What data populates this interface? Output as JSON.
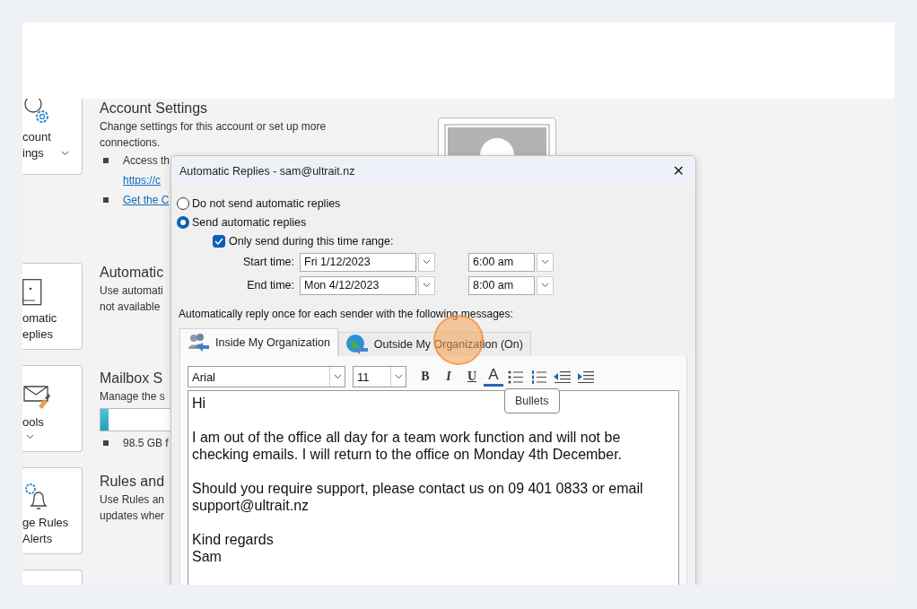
{
  "sidebar": {
    "cards": [
      {
        "lines": [
          "count",
          "ings"
        ]
      },
      {
        "lines": [
          "omatic",
          "eplies"
        ]
      },
      {
        "lines": [
          "ools"
        ]
      },
      {
        "lines": [
          "ge Rules",
          "Alerts"
        ]
      }
    ]
  },
  "sections": [
    {
      "title": "Account Settings",
      "text": [
        "Change settings for this account or set up more",
        "connections."
      ],
      "bullets": [
        {
          "kind": "plain",
          "lines": [
            "Access th"
          ]
        },
        {
          "kind": "link",
          "lines": [
            "https://c"
          ]
        },
        {
          "kind": "bullet-link",
          "lines": [
            "Get the C"
          ]
        }
      ]
    },
    {
      "title": "Automatic",
      "text": [
        "Use automati",
        "not available"
      ]
    },
    {
      "title": "Mailbox S",
      "text": [
        "Manage the s"
      ],
      "storage": {
        "level": 0.03
      },
      "bullets": [
        {
          "kind": "plain",
          "lines": [
            "98.5 GB f"
          ]
        }
      ]
    },
    {
      "title": "Rules and",
      "text": [
        "Use Rules an",
        "updates wher"
      ]
    }
  ],
  "dialog": {
    "title": "Automatic Replies - sam@ultrait.nz",
    "close": "✕",
    "options": [
      {
        "label": "Do not send automatic replies",
        "selected": false
      },
      {
        "label": "Send automatic replies",
        "selected": true
      }
    ],
    "time_range": {
      "label": "Only send during this time range:",
      "checked": true
    },
    "times": [
      {
        "label": "Start time:",
        "date": "Fri 1/12/2023",
        "time": "6:00 am"
      },
      {
        "label": "End time:",
        "date": "Mon 4/12/2023",
        "time": "8:00 am"
      }
    ],
    "instruction": "Automatically reply once for each sender with the following messages:",
    "tabs": [
      {
        "label": "Inside My Organization",
        "selected": true
      },
      {
        "label": "Outside My Organization (On)",
        "selected": false
      }
    ],
    "font": "Arial",
    "size": "11",
    "format": [
      "B",
      "I",
      "U"
    ],
    "font_color": "A",
    "tooltip": "Bullets",
    "message": [
      [
        "Hi"
      ],
      [
        "I am out of the office all day for a team work function and will not be",
        "checking emails. I will return to the office on Monday 4th December."
      ],
      [
        "Should you require support, please contact us on 09 401 0833 or email",
        "support@ultrait.nz"
      ],
      [
        "Kind regards",
        "Sam"
      ]
    ]
  }
}
